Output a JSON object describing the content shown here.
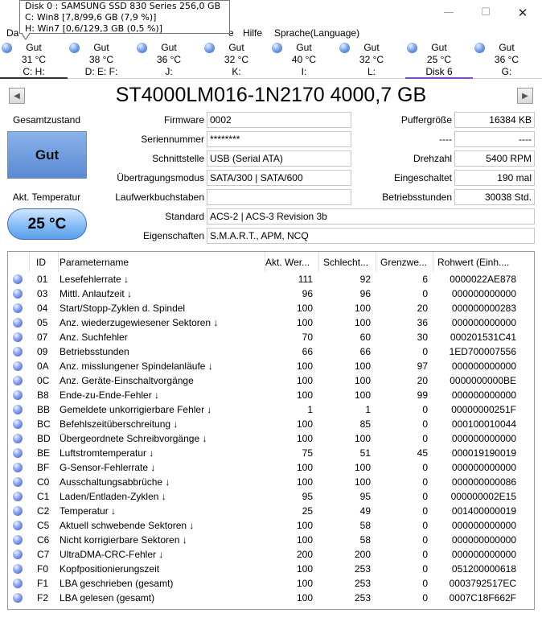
{
  "window": {
    "min_icon": "minimize-icon",
    "max_icon": "maximize-icon",
    "close_icon": "close-icon",
    "min_glyph": "—",
    "max_glyph": "☐",
    "close_glyph": "✕"
  },
  "tooltip": {
    "line1": "Disk 0 : SAMSUNG SSD 830 Series 256,0 GB",
    "line2": "C: Win8 [7,8/99,6 GB (7,9 %)]",
    "line3": "H: Win7 [0,6/129,3 GB (0,5 %)]"
  },
  "menu": {
    "file": "Da",
    "help": "Hilfe",
    "language": "Sprache(Language)",
    "partial": "e"
  },
  "disks": [
    {
      "status": "Gut",
      "temp": "31 °C",
      "letters": "C: H:"
    },
    {
      "status": "Gut",
      "temp": "38 °C",
      "letters": "D: E: F:"
    },
    {
      "status": "Gut",
      "temp": "36 °C",
      "letters": "J:"
    },
    {
      "status": "Gut",
      "temp": "32 °C",
      "letters": "K:"
    },
    {
      "status": "Gut",
      "temp": "40 °C",
      "letters": "I:"
    },
    {
      "status": "Gut",
      "temp": "32 °C",
      "letters": "L:"
    },
    {
      "status": "Gut",
      "temp": "25 °C",
      "letters": "Disk 6"
    },
    {
      "status": "Gut",
      "temp": "36 °C",
      "letters": "G:"
    }
  ],
  "model": {
    "title": "ST4000LM016-1N2170 4000,7 GB",
    "prev_icon": "arrow-left-icon",
    "next_icon": "arrow-right-icon",
    "prev_glyph": "◀",
    "next_glyph": "▶"
  },
  "status": {
    "health_label": "Gesamtzustand",
    "health_value": "Gut",
    "temp_label": "Akt. Temperatur",
    "temp_value": "25 °C"
  },
  "info": {
    "firmware_label": "Firmware",
    "firmware": "0002",
    "serial_label": "Seriennummer",
    "serial": "********",
    "interface_label": "Schnittstelle",
    "interface": "USB (Serial ATA)",
    "transfer_label": "Übertragungsmodus",
    "transfer": "SATA/300 | SATA/600",
    "drive_letters_label": "Laufwerkbuchstaben",
    "drive_letters": "",
    "standard_label": "Standard",
    "standard": "ACS-2 | ACS-3 Revision 3b",
    "features_label": "Eigenschaften",
    "features": "S.M.A.R.T., APM, NCQ",
    "buffer_label": "Puffergröße",
    "buffer": "16384 KB",
    "nv_cache_label": "----",
    "nv_cache": "----",
    "rpm_label": "Drehzahl",
    "rpm": "5400 RPM",
    "power_on_count_label": "Eingeschaltet",
    "power_on_count": "190 mal",
    "power_on_hours_label": "Betriebsstunden",
    "power_on_hours": "30038 Std."
  },
  "smart": {
    "headers": {
      "id": "ID",
      "name": "Parametername",
      "current": "Akt. Wer...",
      "worst": "Schlecht...",
      "threshold": "Grenzwe...",
      "raw": "Rohwert (Einh...."
    },
    "status_icon": "status-good-icon",
    "rows": [
      {
        "id": "01",
        "name": "Lesefehlerrate ↓",
        "current": "111",
        "worst": "92",
        "threshold": "6",
        "raw": "0000022AE878"
      },
      {
        "id": "03",
        "name": "Mittl. Anlaufzeit ↓",
        "current": "96",
        "worst": "96",
        "threshold": "0",
        "raw": "000000000000"
      },
      {
        "id": "04",
        "name": "Start/Stopp-Zyklen d. Spindel",
        "current": "100",
        "worst": "100",
        "threshold": "20",
        "raw": "000000000283"
      },
      {
        "id": "05",
        "name": "Anz. wiederzugewiesener Sektoren ↓",
        "current": "100",
        "worst": "100",
        "threshold": "36",
        "raw": "000000000000"
      },
      {
        "id": "07",
        "name": "Anz. Suchfehler",
        "current": "70",
        "worst": "60",
        "threshold": "30",
        "raw": "000201531C41"
      },
      {
        "id": "09",
        "name": "Betriebsstunden",
        "current": "66",
        "worst": "66",
        "threshold": "0",
        "raw": "1ED700007556"
      },
      {
        "id": "0A",
        "name": "Anz. misslungener Spindelanläufe ↓",
        "current": "100",
        "worst": "100",
        "threshold": "97",
        "raw": "000000000000"
      },
      {
        "id": "0C",
        "name": "Anz. Geräte-Einschaltvorgänge",
        "current": "100",
        "worst": "100",
        "threshold": "20",
        "raw": "0000000000BE"
      },
      {
        "id": "B8",
        "name": "Ende-zu-Ende-Fehler ↓",
        "current": "100",
        "worst": "100",
        "threshold": "99",
        "raw": "000000000000"
      },
      {
        "id": "BB",
        "name": "Gemeldete unkorrigierbare Fehler ↓",
        "current": "1",
        "worst": "1",
        "threshold": "0",
        "raw": "00000000251F"
      },
      {
        "id": "BC",
        "name": "Befehlszeitüberschreitung ↓",
        "current": "100",
        "worst": "85",
        "threshold": "0",
        "raw": "000100010044"
      },
      {
        "id": "BD",
        "name": "Übergeordnete Schreibvorgänge ↓",
        "current": "100",
        "worst": "100",
        "threshold": "0",
        "raw": "000000000000"
      },
      {
        "id": "BE",
        "name": "Luftstromtemperatur ↓",
        "current": "75",
        "worst": "51",
        "threshold": "45",
        "raw": "000019190019"
      },
      {
        "id": "BF",
        "name": "G-Sensor-Fehlerrate ↓",
        "current": "100",
        "worst": "100",
        "threshold": "0",
        "raw": "000000000000"
      },
      {
        "id": "C0",
        "name": "Ausschaltungsabbrüche ↓",
        "current": "100",
        "worst": "100",
        "threshold": "0",
        "raw": "000000000086"
      },
      {
        "id": "C1",
        "name": "Laden/Entladen-Zyklen ↓",
        "current": "95",
        "worst": "95",
        "threshold": "0",
        "raw": "000000002E15"
      },
      {
        "id": "C2",
        "name": "Temperatur ↓",
        "current": "25",
        "worst": "49",
        "threshold": "0",
        "raw": "001400000019"
      },
      {
        "id": "C5",
        "name": "Aktuell schwebende Sektoren ↓",
        "current": "100",
        "worst": "58",
        "threshold": "0",
        "raw": "000000000000"
      },
      {
        "id": "C6",
        "name": "Nicht korrigierbare Sektoren ↓",
        "current": "100",
        "worst": "58",
        "threshold": "0",
        "raw": "000000000000"
      },
      {
        "id": "C7",
        "name": "UltraDMA-CRC-Fehler ↓",
        "current": "200",
        "worst": "200",
        "threshold": "0",
        "raw": "000000000000"
      },
      {
        "id": "F0",
        "name": "Kopfpositionierungszeit",
        "current": "100",
        "worst": "253",
        "threshold": "0",
        "raw": "051200000618"
      },
      {
        "id": "F1",
        "name": "LBA geschrieben (gesamt)",
        "current": "100",
        "worst": "253",
        "threshold": "0",
        "raw": "0003792517EC"
      },
      {
        "id": "F2",
        "name": "LBA gelesen (gesamt)",
        "current": "100",
        "worst": "253",
        "threshold": "0",
        "raw": "0007C18F662F"
      }
    ]
  }
}
